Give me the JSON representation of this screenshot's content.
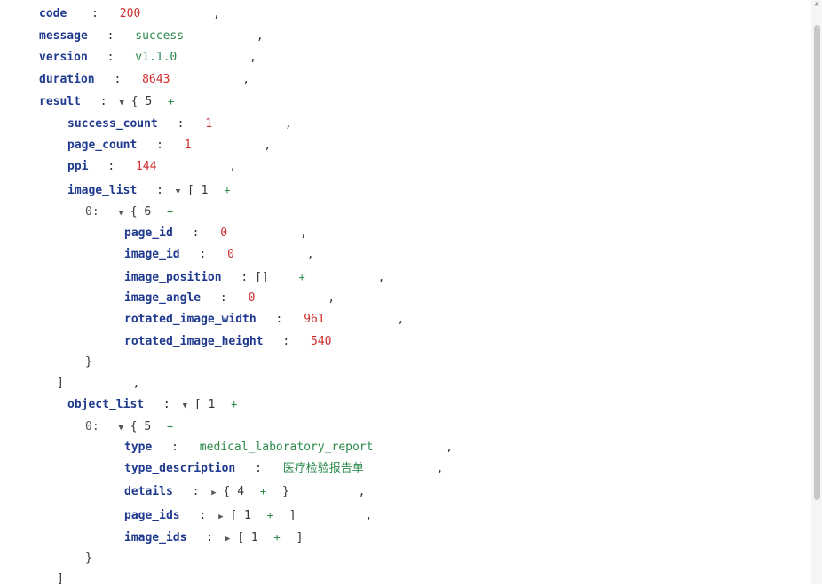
{
  "json": {
    "code": "200",
    "message": "success",
    "version": "v1.1.0",
    "duration": "8643",
    "result": {
      "count": "5",
      "success_count": "1",
      "page_count": "1",
      "ppi": "144",
      "image_list": {
        "count": "1",
        "item0": {
          "index": "0:",
          "count": "6",
          "page_id": "0",
          "image_id": "0",
          "image_position": "[]",
          "image_angle": "0",
          "rotated_image_width": "961",
          "rotated_image_height": "540"
        }
      },
      "object_list": {
        "count": "1",
        "item0": {
          "index": "0:",
          "count": "5",
          "type": "medical_laboratory_report",
          "type_description": "医疗检验报告单",
          "details_count": "4",
          "page_ids_count": "1",
          "image_ids_count": "1"
        }
      }
    }
  },
  "keys": {
    "code": "code",
    "message": "message",
    "version": "version",
    "duration": "duration",
    "result": "result",
    "success_count": "success_count",
    "page_count": "page_count",
    "ppi": "ppi",
    "image_list": "image_list",
    "page_id": "page_id",
    "image_id": "image_id",
    "image_position": "image_position",
    "image_angle": "image_angle",
    "rotated_image_width": "rotated_image_width",
    "rotated_image_height": "rotated_image_height",
    "object_list": "object_list",
    "type": "type",
    "type_description": "type_description",
    "details": "details",
    "page_ids": "page_ids",
    "image_ids": "image_ids"
  },
  "symbols": {
    "colon": ":",
    "comma": ",",
    "plus": "+",
    "open_brace": "{",
    "close_brace": "}",
    "open_bracket": "[",
    "close_bracket": "]",
    "expanded_icon": "▼",
    "collapsed_icon": "▶"
  },
  "icons": {
    "expand": "caret-down-icon",
    "collapse": "caret-right-icon",
    "add": "plus-icon"
  },
  "colors": {
    "key": "#1f3a8f",
    "number": "#d02d2d",
    "string": "#2a8a4a",
    "plus": "#2a8a4a"
  }
}
